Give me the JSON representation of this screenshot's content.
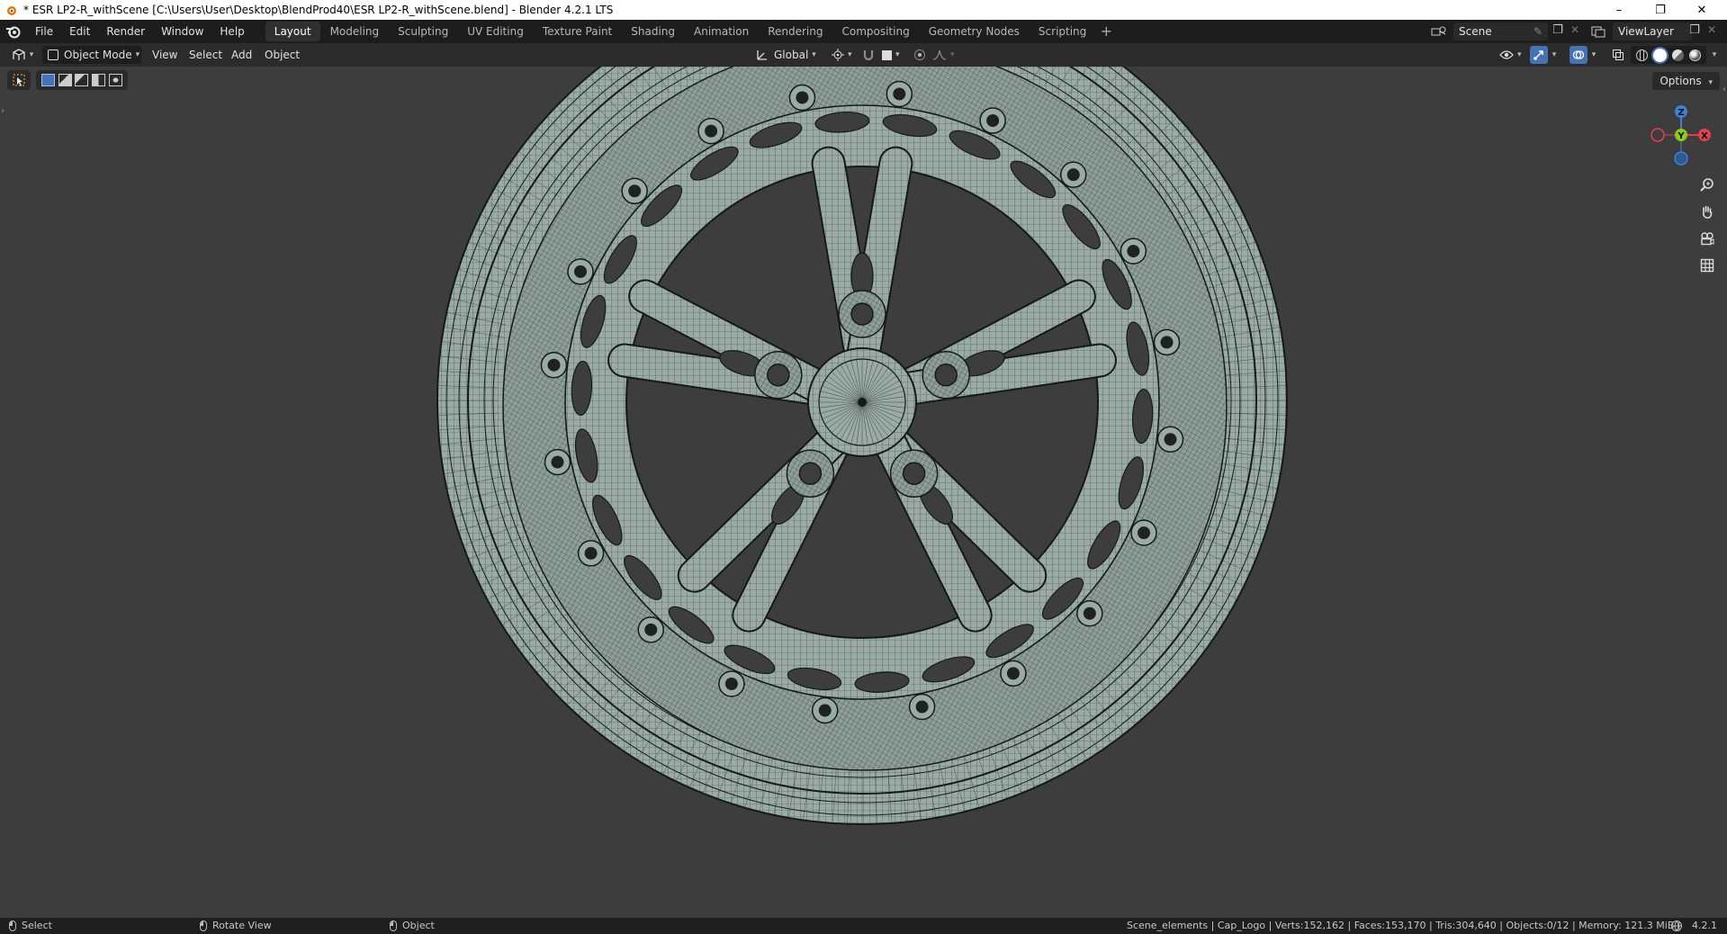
{
  "window": {
    "title": "* ESR LP2-R_withScene [C:\\Users\\User\\Desktop\\BlendProd40\\ESR LP2-R_withScene.blend] - Blender 4.2.1 LTS",
    "controls": {
      "minimize": "–",
      "maximize": "❐",
      "close": "✕"
    }
  },
  "topbar": {
    "menus": [
      "File",
      "Edit",
      "Render",
      "Window",
      "Help"
    ],
    "workspaces": [
      "Layout",
      "Modeling",
      "Sculpting",
      "UV Editing",
      "Texture Paint",
      "Shading",
      "Animation",
      "Rendering",
      "Compositing",
      "Geometry Nodes",
      "Scripting"
    ],
    "active_workspace": "Layout",
    "add_workspace": "+",
    "scene": "Scene",
    "view_layer": "ViewLayer"
  },
  "header": {
    "mode": "Object Mode",
    "menus": [
      "View",
      "Select",
      "Add",
      "Object"
    ],
    "orientation": "Global"
  },
  "viewport": {
    "options_label": "Options",
    "gizmo": {
      "z": "Z",
      "y": "Y",
      "x": "X"
    },
    "nav_icons": [
      "zoom-icon",
      "pan-hand-icon",
      "camera-icon",
      "grid-icon"
    ]
  },
  "statusbar": {
    "left_click": "Select",
    "middle_click": "Rotate View",
    "right_click": "Object",
    "stats": "Scene_elements | Cap_Logo | Verts:152,162 | Faces:153,170 | Tris:304,640 | Objects:0/12 | Memory: 121.3 MiB |",
    "version": "4.2.1"
  },
  "colors": {
    "axis_x": "#e0414f",
    "axis_y": "#8ccb16",
    "axis_z": "#3b82d6",
    "mesh_fill": "#9aaba6",
    "wire": "#151a19",
    "viewport_bg": "#3d3d3d"
  }
}
